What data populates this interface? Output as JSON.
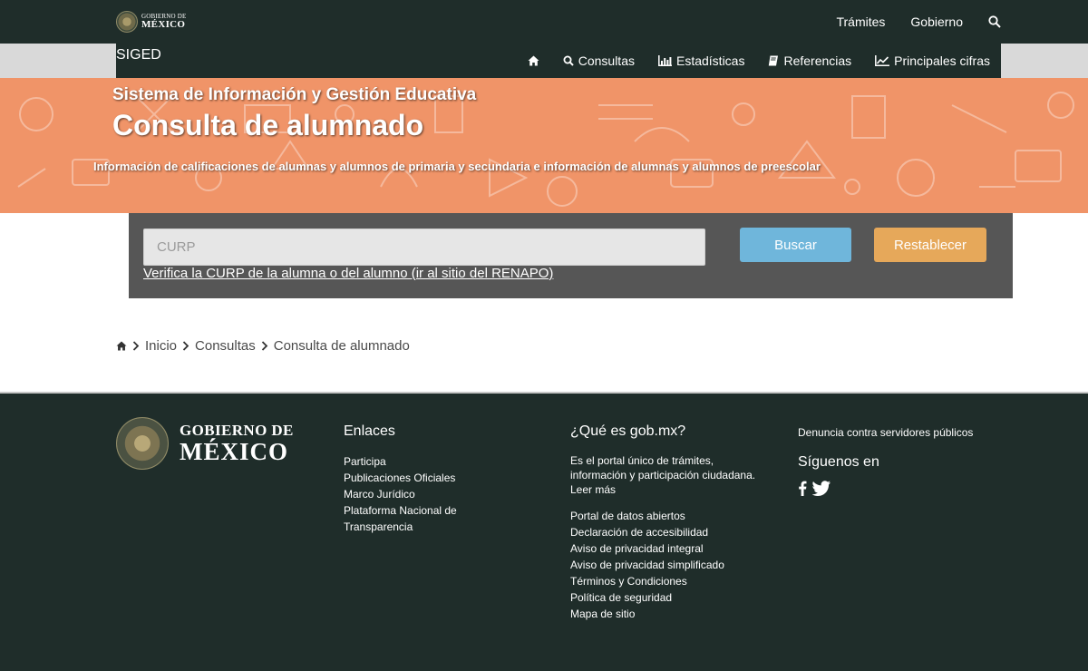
{
  "topbar": {
    "logo_line1": "GOBIERNO DE",
    "logo_line2": "MÉXICO",
    "links": [
      "Trámites",
      "Gobierno"
    ]
  },
  "nav": {
    "title": "SIGED",
    "items": [
      {
        "label": "Consultas",
        "icon": "search-icon"
      },
      {
        "label": "Estadísticas",
        "icon": "bar-chart-icon"
      },
      {
        "label": "Referencias",
        "icon": "book-icon"
      },
      {
        "label": "Principales cifras",
        "icon": "line-chart-icon"
      }
    ]
  },
  "banner": {
    "subtitle": "Sistema de Información y Gestión Educativa",
    "title": "Consulta de alumnado",
    "description": "Información de calificaciones de alumnas y alumnos de primaria y secundaria e información de alumnas y alumnos de preescolar"
  },
  "search": {
    "placeholder": "CURP",
    "value": "",
    "search_button": "Buscar",
    "reset_button": "Restablecer",
    "renapo_link": "Verifica la CURP de la alumna o del alumno (ir al sitio del RENAPO)"
  },
  "breadcrumb": [
    "Inicio",
    "Consultas",
    "Consulta de alumnado"
  ],
  "footer": {
    "logo_line1": "GOBIERNO DE",
    "logo_line2": "MÉXICO",
    "enlaces": {
      "heading": "Enlaces",
      "items": [
        "Participa",
        "Publicaciones Oficiales",
        "Marco Jurídico",
        "Plataforma Nacional de Transparencia"
      ]
    },
    "gobmx": {
      "heading": "¿Qué es gob.mx?",
      "description": "Es el portal único de trámites, información y participación ciudadana. Leer más",
      "items": [
        "Portal de datos abiertos",
        "Declaración de accesibilidad",
        "Aviso de privacidad integral",
        "Aviso de privacidad simplificado",
        "Términos y Condiciones",
        "Política de seguridad",
        "Mapa de sitio"
      ]
    },
    "right": {
      "denuncia": "Denuncia contra servidores públicos",
      "social_heading": "Síguenos en"
    }
  },
  "colors": {
    "dark_green": "#1f2d2a",
    "banner_orange": "#f09468",
    "panel_grey": "#565656",
    "search_blue": "#6fb6db",
    "reset_orange": "#e6a85a"
  }
}
